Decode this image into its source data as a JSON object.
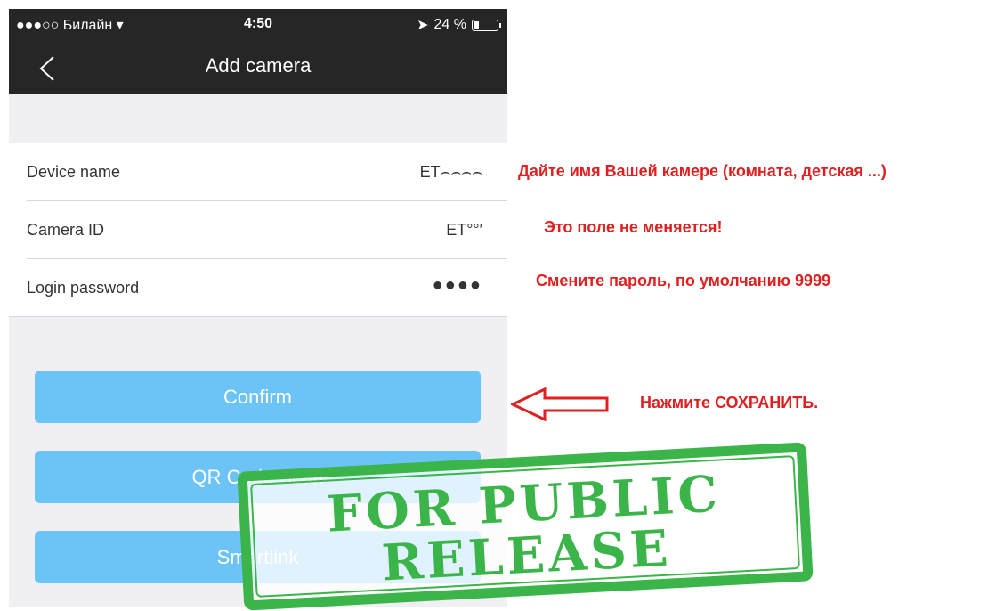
{
  "status_bar": {
    "carrier": "●●●○○ Билайн",
    "time": "4:50",
    "battery_text": "24 %",
    "battery_level": 0.24
  },
  "nav": {
    "title": "Add camera"
  },
  "form": {
    "rows": [
      {
        "label": "Device name",
        "value": "ET⌢⌢⌢⌢"
      },
      {
        "label": "Camera ID",
        "value": "ET°°′"
      },
      {
        "label": "Login password",
        "value": "●●●●"
      }
    ]
  },
  "buttons": {
    "confirm": "Confirm",
    "qr": "QR Code Scan",
    "smartlink": "Smartlink"
  },
  "annotations": {
    "name_hint": "Дайте имя Вашей камере (комната, детская ...)",
    "id_hint": "Это поле не меняется!",
    "password_hint": "Смените пароль, по умолчанию 9999",
    "save_hint": "Нажмите СОХРАНИТЬ."
  },
  "stamp": {
    "line1": "FOR PUBLIC",
    "line2": "RELEASE"
  },
  "colors": {
    "nav_bg": "#262626",
    "button": "#6cc4f6",
    "annotation": "#e02020",
    "stamp": "#3bb54a"
  }
}
